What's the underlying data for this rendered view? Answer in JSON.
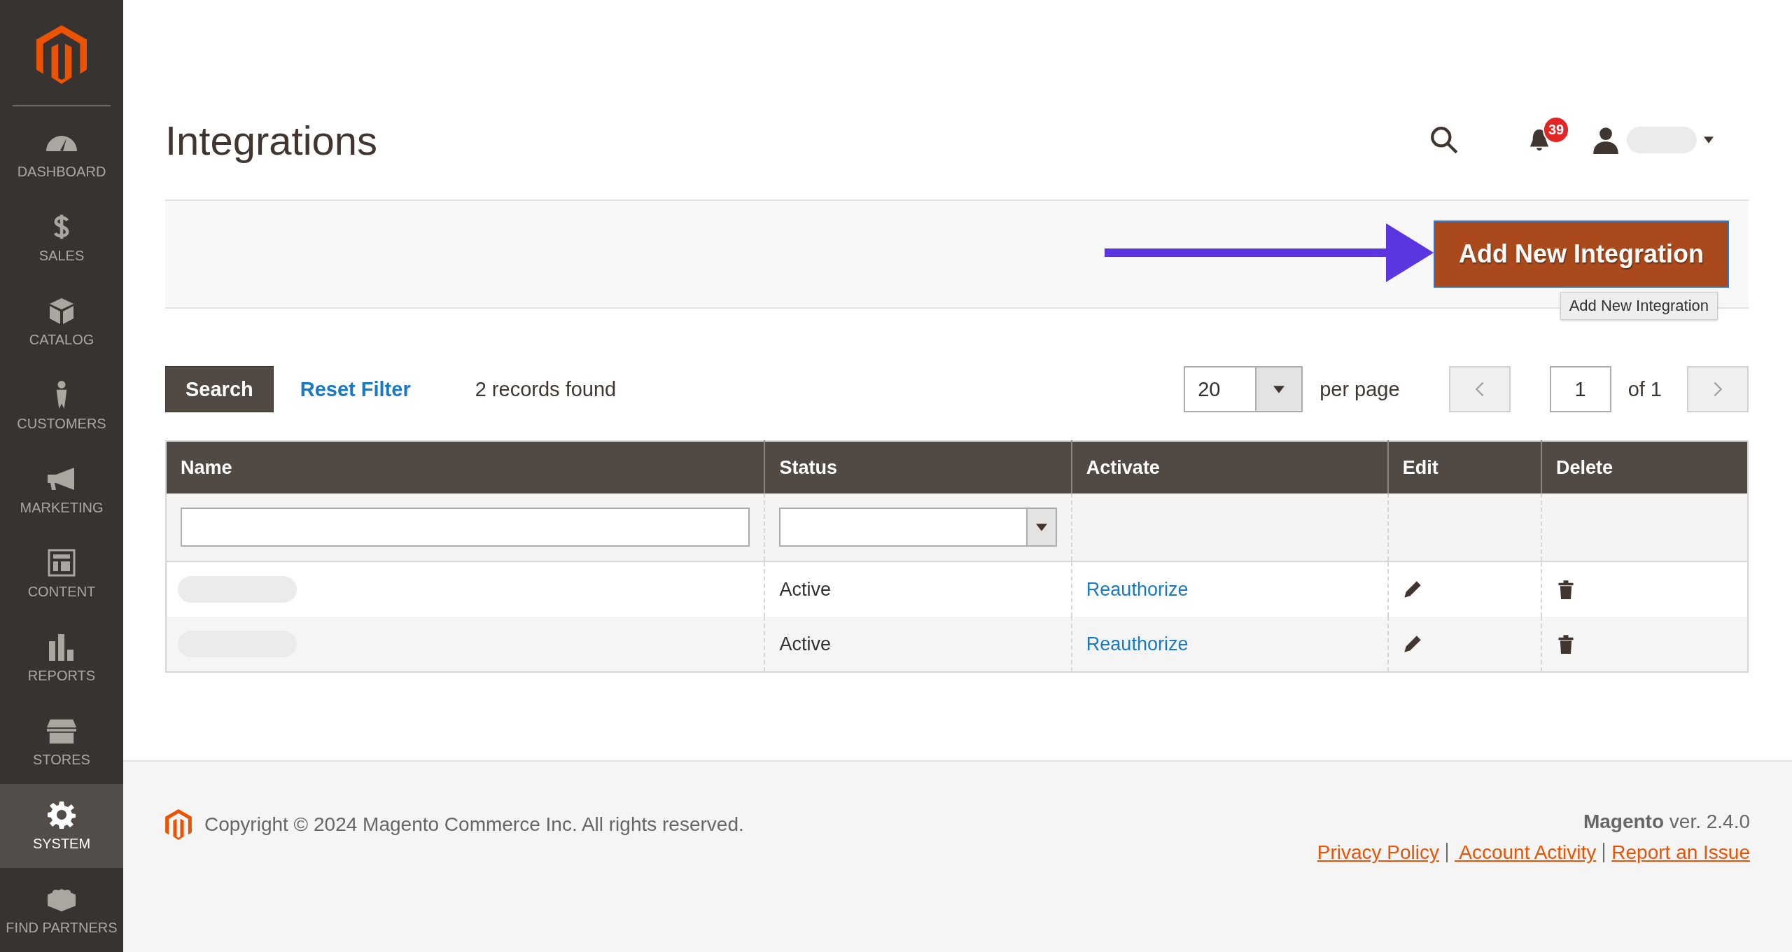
{
  "sidebar": {
    "items": [
      {
        "label": "DASHBOARD",
        "kind": "gauge",
        "selected": false
      },
      {
        "label": "SALES",
        "kind": "dollar",
        "selected": false
      },
      {
        "label": "CATALOG",
        "kind": "box",
        "selected": false
      },
      {
        "label": "CUSTOMERS",
        "kind": "person",
        "selected": false
      },
      {
        "label": "MARKETING",
        "kind": "megaphone",
        "selected": false
      },
      {
        "label": "CONTENT",
        "kind": "layout",
        "selected": false
      },
      {
        "label": "REPORTS",
        "kind": "bars",
        "selected": false
      },
      {
        "label": "STORES",
        "kind": "store",
        "selected": false
      },
      {
        "label": "SYSTEM",
        "kind": "gear",
        "selected": true
      },
      {
        "label": "FIND PARTNERS",
        "kind": "blocks",
        "selected": false
      }
    ]
  },
  "header": {
    "title": "Integrations",
    "notification_count": "39"
  },
  "action_bar": {
    "button": "Add New Integration",
    "tooltip": "Add New Integration"
  },
  "toolbar": {
    "search_button": "Search",
    "reset_filter": "Reset Filter",
    "records_found": "2 records found",
    "per_page": "20",
    "per_page_label": "per page",
    "page": "1",
    "page_total": "of 1"
  },
  "table": {
    "columns": [
      "Name",
      "Status",
      "Activate",
      "Edit",
      "Delete"
    ],
    "rows": [
      {
        "status": "Active",
        "activate": "Reauthorize"
      },
      {
        "status": "Active",
        "activate": "Reauthorize"
      }
    ]
  },
  "footer": {
    "copyright": "Copyright © 2024 Magento Commerce Inc. All rights reserved.",
    "version": "**Magento** ver. 2.4.0",
    "links": [
      "Privacy Policy",
      " Account Activity",
      "Report an Issue"
    ]
  }
}
